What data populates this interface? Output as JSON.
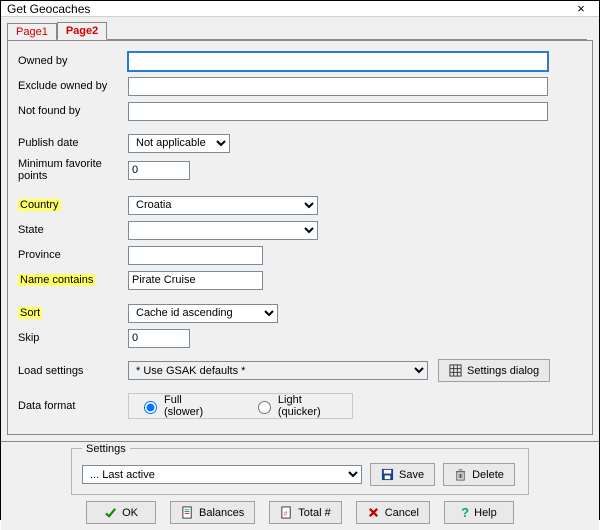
{
  "window": {
    "title": "Get Geocaches",
    "close": "×"
  },
  "tabs": {
    "page1": "Page1",
    "page2": "Page2"
  },
  "labels": {
    "owned_by": "Owned by",
    "exclude_owned_by": "Exclude owned by",
    "not_found_by": "Not found by",
    "publish_date": "Publish date",
    "min_fav": "Minimum favorite points",
    "country": "Country",
    "state": "State",
    "province": "Province",
    "name_contains": "Name contains",
    "sort": "Sort",
    "skip": "Skip",
    "load_settings": "Load settings",
    "data_format": "Data format"
  },
  "values": {
    "owned_by": "",
    "exclude_owned_by": "",
    "not_found_by": "",
    "publish_date": "Not applicable",
    "min_fav": "0",
    "country": "Croatia",
    "state": "",
    "province": "",
    "name_contains": "Pirate Cruise",
    "sort": "Cache id ascending",
    "skip": "0",
    "load_settings": "* Use GSAK defaults *"
  },
  "radio": {
    "full": "Full (slower)",
    "light": "Light (quicker)",
    "selected": "full"
  },
  "buttons": {
    "settings_dialog": "Settings dialog",
    "save": "Save",
    "delete": "Delete",
    "ok": "OK",
    "balances": "Balances",
    "total": "Total #",
    "cancel": "Cancel",
    "help": "Help"
  },
  "settings_group": {
    "legend": "Settings",
    "selected": "... Last active"
  }
}
